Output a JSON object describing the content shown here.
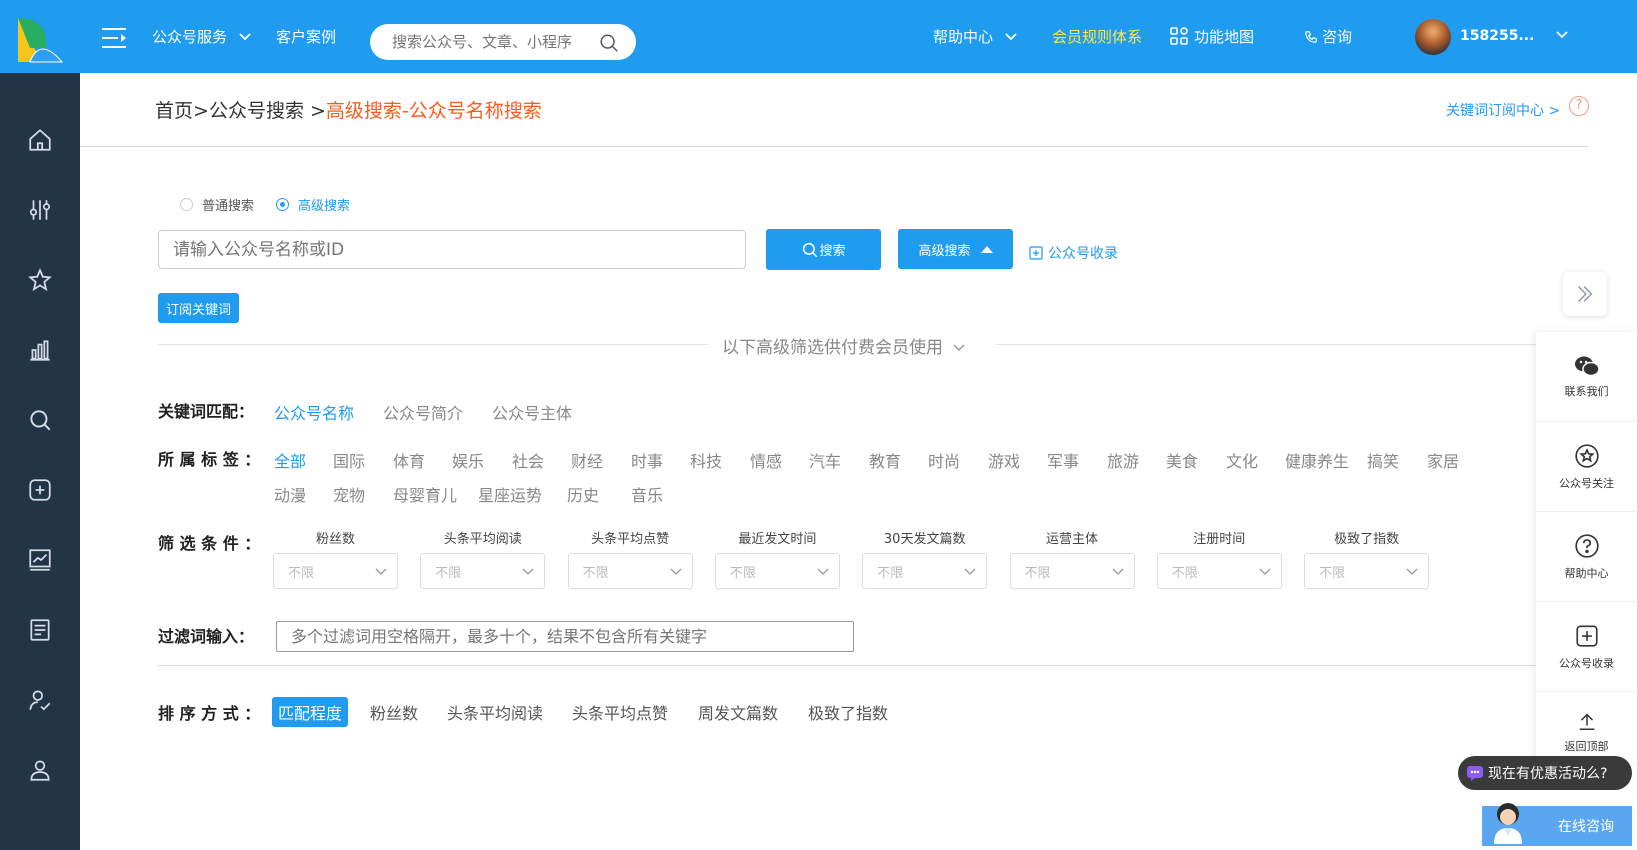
{
  "colors": {
    "brand": "#1f9bf0",
    "sidebar": "#243447",
    "accent_orange": "#ff5a1f",
    "vip_yellow": "#ffe84a"
  },
  "topbar": {
    "service_menu": "公众号服务",
    "cases": "客户案例",
    "search_placeholder": "搜索公众号、文章、小程序",
    "help_center": "帮助中心",
    "member_rules": "会员规则体系",
    "feature_map": "功能地图",
    "consult": "咨询",
    "user_id": "158255..."
  },
  "sidebar": {
    "items": [
      "home-icon",
      "filter-icon",
      "star-icon",
      "bar-chart-icon",
      "search-icon",
      "plus-icon",
      "trend-icon",
      "document-icon",
      "user-check-icon",
      "user-icon"
    ]
  },
  "breadcrumb": {
    "home": "首页",
    "sep": ">",
    "search": "公众号搜索",
    "sep2": " >",
    "current": "高级搜索-公众号名称搜索"
  },
  "keyword_center": "关键词订阅中心 >",
  "search_mode": {
    "normal": "普通搜索",
    "advanced": "高级搜索",
    "selected": "高级搜索"
  },
  "search": {
    "placeholder": "请输入公众号名称或ID",
    "search_btn": "搜索",
    "advanced_btn": "高级搜索",
    "collect_link": "公众号收录",
    "subscribe_btn": "订阅关键词"
  },
  "divider_text": "以下高级筛选供付费会员使用",
  "keyword_match": {
    "label": "关键词匹配：",
    "options": [
      "公众号名称",
      "公众号简介",
      "公众号主体"
    ],
    "active": "公众号名称"
  },
  "tags": {
    "label": "所 属 标 签 ：",
    "row1": [
      "全部",
      "国际",
      "体育",
      "娱乐",
      "社会",
      "财经",
      "时事",
      "科技",
      "情感",
      "汽车",
      "教育",
      "时尚",
      "游戏",
      "军事",
      "旅游",
      "美食",
      "文化",
      "健康养生",
      "搞笑",
      "家居"
    ],
    "row2": [
      "动漫",
      "宠物",
      "母婴育儿",
      "星座运势",
      "历史",
      "音乐"
    ],
    "active": "全部"
  },
  "filters": {
    "label": "筛 选 条 件 ：",
    "items": [
      {
        "title": "粉丝数",
        "value": "不限"
      },
      {
        "title": "头条平均阅读",
        "value": "不限"
      },
      {
        "title": "头条平均点赞",
        "value": "不限"
      },
      {
        "title": "最近发文时间",
        "value": "不限"
      },
      {
        "title": "30天发文篇数",
        "value": "不限"
      },
      {
        "title": "运营主体",
        "value": "不限"
      },
      {
        "title": "注册时间",
        "value": "不限"
      },
      {
        "title": "极致了指数",
        "value": "不限"
      }
    ]
  },
  "filter_words": {
    "label": "过滤词输入：",
    "placeholder": "多个过滤词用空格隔开，最多十个，结果不包含所有关键字"
  },
  "sort": {
    "label": "排 序 方 式 ：",
    "options": [
      "匹配程度",
      "粉丝数",
      "头条平均阅读",
      "头条平均点赞",
      "周发文篇数",
      "极致了指数"
    ],
    "active": "匹配程度"
  },
  "float_panel": {
    "contact": "联系我们",
    "follow": "公众号关注",
    "help": "帮助中心",
    "collect": "公众号收录",
    "top": "返回顶部"
  },
  "promo_text": "现在有优惠活动么?",
  "online_consult": "在线咨询"
}
